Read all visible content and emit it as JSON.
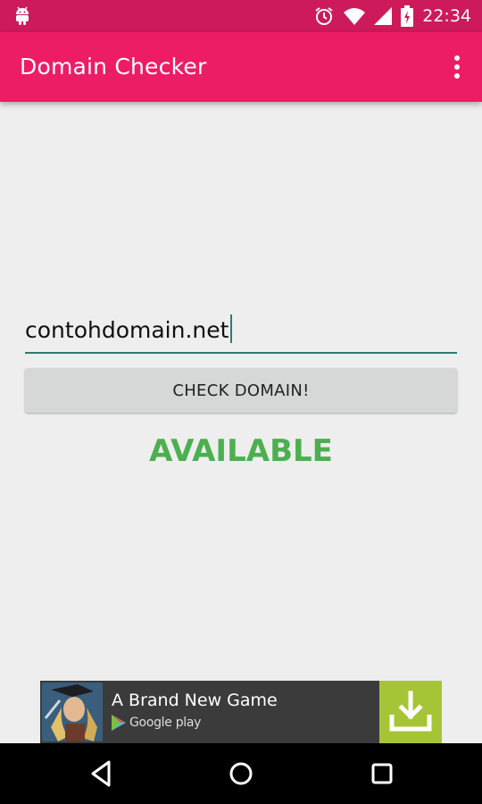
{
  "status_bar": {
    "time": "22:34",
    "icons": [
      "android-icon",
      "alarm-icon",
      "wifi-icon",
      "signal-icon",
      "battery-icon"
    ],
    "background": "#cd1a5a"
  },
  "app_bar": {
    "title": "Domain Checker",
    "menu_icon": "overflow-menu-icon",
    "background": "#ec1d64"
  },
  "form": {
    "domain_value": "contohdomain.net",
    "button_label": "CHECK DOMAIN!",
    "underline_color": "#2f7a74"
  },
  "result": {
    "text": "AVAILABLE",
    "color": "#4caf50"
  },
  "ad": {
    "title": "A Brand New Game",
    "store": "Google play",
    "download_icon": "download-icon",
    "accent": "#a5c536"
  },
  "nav_bar": {
    "buttons": [
      "back-icon",
      "home-icon",
      "recents-icon"
    ]
  }
}
